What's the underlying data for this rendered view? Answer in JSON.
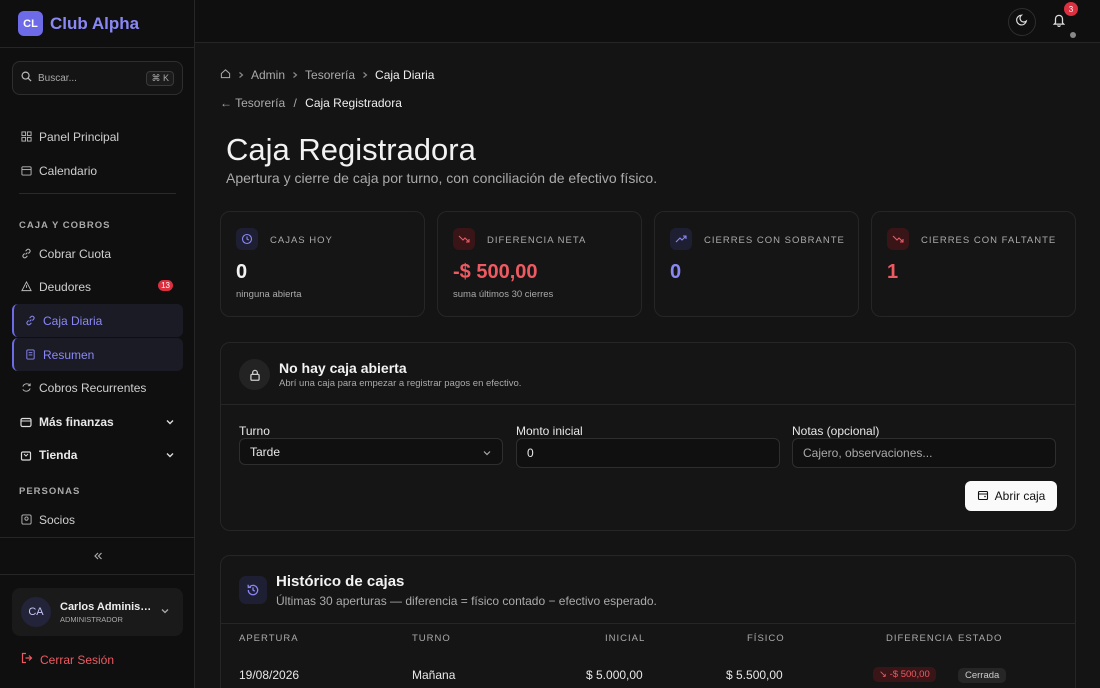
{
  "brand": {
    "logo_text": "CL",
    "name": "Club Alpha"
  },
  "search": {
    "placeholder": "Buscar...",
    "shortcut": "⌘ K"
  },
  "sidebar": {
    "items_top": [
      {
        "label": "Panel Principal",
        "icon": "dashboard-icon"
      },
      {
        "label": "Calendario",
        "icon": "calendar-icon"
      }
    ],
    "section_caja": "CAJA Y COBROS",
    "items_caja": [
      {
        "label": "Cobrar Cuota",
        "icon": "link-icon"
      },
      {
        "label": "Deudores",
        "icon": "warning-icon",
        "badge": "13"
      },
      {
        "label": "Caja Diaria",
        "icon": "link-icon"
      },
      {
        "label": "Resumen",
        "icon": "receipt-icon"
      },
      {
        "label": "Cobros Recurrentes",
        "icon": "refresh-icon"
      }
    ],
    "groups": [
      {
        "label": "Más finanzas",
        "icon": "wallet-icon"
      },
      {
        "label": "Tienda",
        "icon": "bag-icon"
      }
    ],
    "section_personas": "PERSONAS",
    "items_personas": [
      {
        "label": "Socios",
        "icon": "user-icon"
      }
    ]
  },
  "user": {
    "initials": "CA",
    "name": "Carlos Administrador",
    "role": "ADMINISTRADOR"
  },
  "logout_label": "Cerrar Sesión",
  "topbar": {
    "notification_count": "3"
  },
  "breadcrumb": [
    "Admin",
    "Tesorería",
    "Caja Diaria"
  ],
  "back": {
    "parent": "← Tesorería",
    "sep": "/",
    "current": "Caja Registradora"
  },
  "page": {
    "title": "Caja Registradora",
    "subtitle": "Apertura y cierre de caja por turno, con conciliación de efectivo físico."
  },
  "stats": [
    {
      "label": "CAJAS HOY",
      "value": "0",
      "note": "ninguna abierta",
      "icon": "clock-icon"
    },
    {
      "label": "DIFERENCIA NETA",
      "value": "-$ 500,00",
      "note": "suma últimos 30 cierres",
      "icon": "trend-down-icon"
    },
    {
      "label": "CIERRES CON SOBRANTE",
      "value": "0",
      "note": "",
      "icon": "trend-up-icon"
    },
    {
      "label": "CIERRES CON FALTANTE",
      "value": "1",
      "note": "",
      "icon": "trend-down-icon"
    }
  ],
  "open_box": {
    "title": "No hay caja abierta",
    "subtitle": "Abrí una caja para empezar a registrar pagos en efectivo.",
    "turno_label": "Turno",
    "turno_value": "Tarde",
    "monto_label": "Monto inicial",
    "monto_value": "0",
    "notas_label": "Notas (opcional)",
    "notas_placeholder": "Cajero, observaciones...",
    "button_label": "Abrir caja"
  },
  "history": {
    "title": "Histórico de cajas",
    "subtitle": "Últimas 30 aperturas — diferencia = físico contado − efectivo esperado.",
    "columns": [
      "APERTURA",
      "TURNO",
      "INICIAL",
      "FÍSICO",
      "DIFERENCIA",
      "ESTADO"
    ],
    "rows": [
      {
        "apertura": "19/08/2026",
        "turno": "Mañana",
        "inicial": "$ 5.000,00",
        "fisico": "$ 5.500,00",
        "diferencia": "-$ 500,00",
        "estado": "Cerrada"
      }
    ]
  },
  "colors": {
    "accent": "#6d6be8",
    "negative": "#ef5a62",
    "positive_blue": "#8a88f5"
  }
}
